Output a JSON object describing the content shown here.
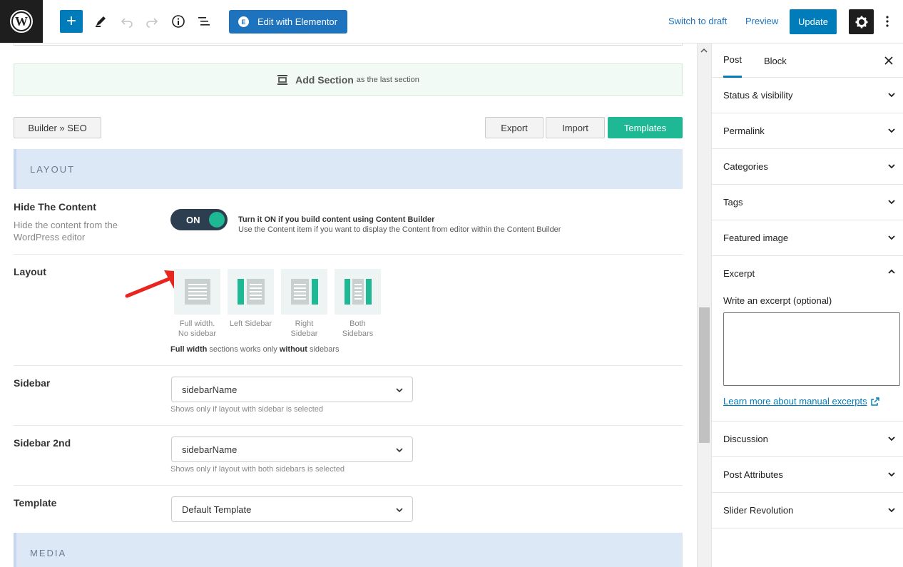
{
  "topbar": {
    "elementor_label": "Edit with Elementor",
    "switch_draft": "Switch to draft",
    "preview": "Preview",
    "update": "Update"
  },
  "editor": {
    "add_section_bold": "Add Section",
    "add_section_rest": "as the last section",
    "builder_btn": "Builder » SEO",
    "export": "Export",
    "import": "Import",
    "templates": "Templates",
    "layout_heading": "LAYOUT",
    "media_heading": "MEDIA",
    "hide_content": {
      "title": "Hide The Content",
      "desc": "Hide the content from the WordPress editor",
      "toggle": "ON",
      "info_title": "Turn it ON if you build content using Content Builder",
      "info_desc": "Use the Content item if you want to display the Content from editor within the Content Builder"
    },
    "layout": {
      "title": "Layout",
      "options": [
        {
          "line1": "Full width.",
          "line2": "No sidebar"
        },
        {
          "line1": "Left Sidebar",
          "line2": ""
        },
        {
          "line1": "Right",
          "line2": "Sidebar"
        },
        {
          "line1": "Both",
          "line2": "Sidebars"
        }
      ],
      "note_a": "Full width",
      "note_b": " sections works only ",
      "note_c": "without",
      "note_d": " sidebars"
    },
    "sidebar": {
      "title": "Sidebar",
      "value": "sidebarName",
      "hint": "Shows only if layout with sidebar is selected"
    },
    "sidebar2": {
      "title": "Sidebar 2nd",
      "value": "sidebarName",
      "hint": "Shows only if layout with both sidebars is selected"
    },
    "template": {
      "title": "Template",
      "value": "Default Template"
    }
  },
  "sidebar": {
    "tabs": [
      "Post",
      "Block"
    ],
    "panels_top": [
      "Status & visibility",
      "Permalink",
      "Categories",
      "Tags",
      "Featured image"
    ],
    "excerpt": {
      "title": "Excerpt",
      "label": "Write an excerpt (optional)",
      "link": "Learn more about manual excerpts"
    },
    "panels_bottom": [
      "Discussion",
      "Post Attributes",
      "Slider Revolution"
    ]
  },
  "colors": {
    "accent": "#007cba",
    "elementor": "#1e73be",
    "green": "#1fb895",
    "dark": "#1e1e1e"
  }
}
